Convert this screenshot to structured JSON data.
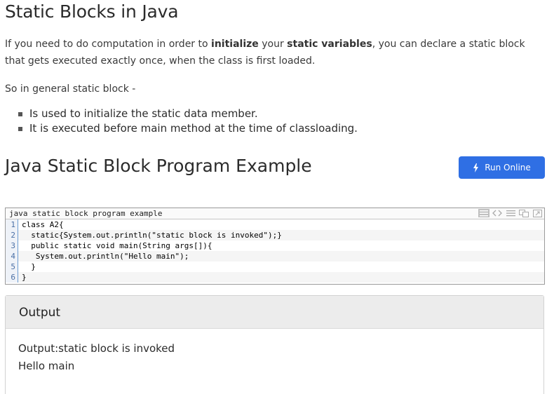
{
  "heading1": "Static Blocks in Java",
  "intro": {
    "part1": "If you need to do computation in order to ",
    "bold1": "initialize",
    "part2": " your ",
    "bold2": "static variables",
    "part3": ", you can declare a static block that gets executed exactly once, when the class is first loaded."
  },
  "general": "So in general static block -",
  "bullets": [
    "Is used to initialize the static data member.",
    "It is executed before main method at the time of classloading."
  ],
  "heading2": "Java Static Block Program Example",
  "run_button": {
    "label": "Run Online",
    "icon": "bolt-icon",
    "color": "#2f6fe4"
  },
  "code": {
    "title": "java static block program example",
    "tools": [
      "view-plain-icon",
      "view-source-icon",
      "copy-to-clipboard-icon",
      "print-icon",
      "help-icon"
    ],
    "line_numbers": [
      "1",
      "2",
      "3",
      "4",
      "5",
      "6"
    ],
    "lines": [
      "class A2{",
      "  static{System.out.println(\"static block is invoked\");}",
      "  public static void main(String args[]){",
      "   System.out.println(\"Hello main\");",
      "  }",
      "}"
    ]
  },
  "output": {
    "heading": "Output",
    "lines": [
      "Output:static block is invoked",
      "Hello main"
    ]
  }
}
